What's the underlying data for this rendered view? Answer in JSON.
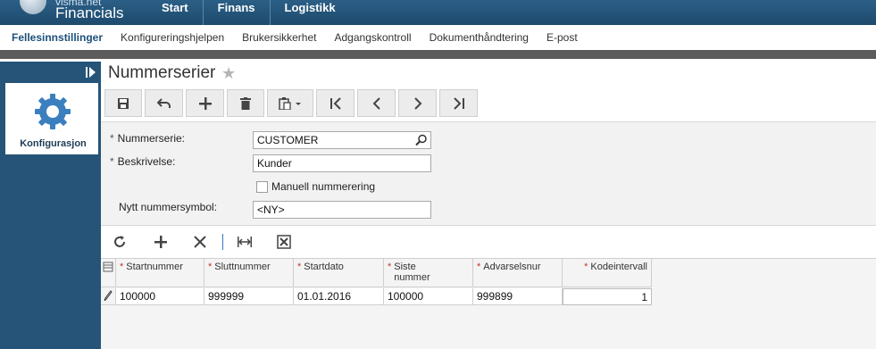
{
  "app": {
    "brand_small": "visma.net",
    "brand": "Financials"
  },
  "topnav": {
    "items": [
      "Start",
      "Finans",
      "Logistikk"
    ]
  },
  "subnav": {
    "items": [
      "Fellesinnstillinger",
      "Konfigureringshjelpen",
      "Brukersikkerhet",
      "Adgangskontroll",
      "Dokumenthåndtering",
      "E-post"
    ],
    "active_index": 0
  },
  "sidebar": {
    "tile_label": "Konfigurasjon"
  },
  "page": {
    "title": "Nummerserier"
  },
  "toolbar": {
    "icons": [
      "save-icon",
      "undo-icon",
      "add-icon",
      "delete-icon",
      "paste-icon",
      "first-record-icon",
      "previous-record-icon",
      "next-record-icon",
      "last-record-icon"
    ]
  },
  "form": {
    "series_label": "Nummerserie:",
    "series_value": "CUSTOMER",
    "description_label": "Beskrivelse:",
    "description_value": "Kunder",
    "manual_label": "Manuell nummerering",
    "manual_checked": false,
    "symbol_label": "Nytt nummersymbol:",
    "symbol_value": "<NY>",
    "required_mark": "*"
  },
  "grid": {
    "columns": [
      {
        "label": "Startnummer",
        "required": true
      },
      {
        "label": "Sluttnummer",
        "required": true
      },
      {
        "label": "Startdato",
        "required": true
      },
      {
        "label": "Siste nummer",
        "required": true
      },
      {
        "label": "Advarselsnur",
        "required": true
      },
      {
        "label": "Kodeintervall",
        "required": true
      }
    ],
    "rows": [
      [
        "100000",
        "999999",
        "01.01.2016",
        "100000",
        "999899",
        "1"
      ]
    ]
  },
  "colors": {
    "topbar": "#1d4a6d",
    "sidebar": "#255478",
    "accent": "#1d4f7a",
    "required": "#c0392b"
  }
}
